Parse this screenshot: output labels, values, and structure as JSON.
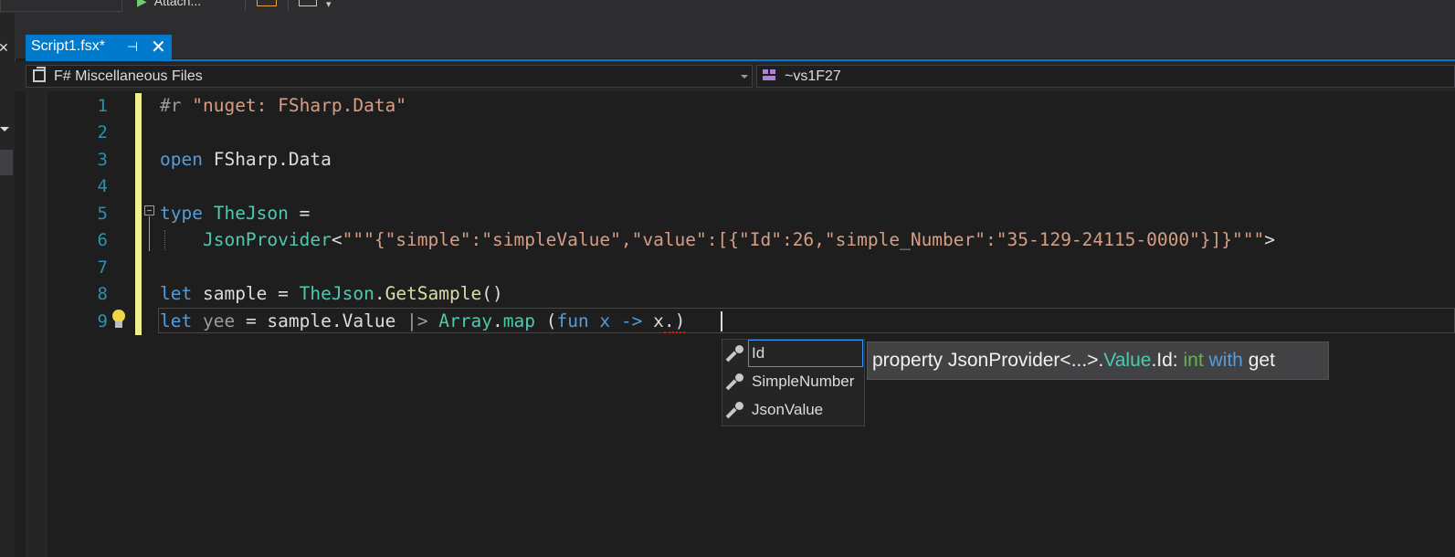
{
  "toolbar": {
    "attach_label": "Attach..."
  },
  "tab": {
    "title": "Script1.fsx*",
    "pin_glyph": "⊣",
    "close_glyph": "✕"
  },
  "nav": {
    "project": "F# Miscellaneous Files",
    "scope": "~vs1F27"
  },
  "line_numbers": [
    "1",
    "2",
    "3",
    "4",
    "5",
    "6",
    "7",
    "8",
    "9"
  ],
  "code": {
    "l1_pp": "#r ",
    "l1_str": "\"nuget: FSharp.Data\"",
    "l3_kw": "open",
    "l3_rest": " FSharp.Data",
    "l5_kw": "type",
    "l5_ty": "TheJson",
    "l5_rest": " =",
    "l6_ty": "JsonProvider",
    "l6_lt": "<",
    "l6_str": "\"\"\"{\"simple\":\"simpleValue\",\"value\":[{\"Id\":26,\"simple_Number\":\"35-129-24115-0000\"}]}\"\"\"",
    "l6_gt": ">",
    "l8_kw": "let",
    "l8_a": " sample = ",
    "l8_ty": "TheJson",
    "l8_dot": ".",
    "l8_fn": "GetSample",
    "l8_paren": "()",
    "l9_kw": "let",
    "l9_name": " yee",
    "l9_a": " = sample.Value ",
    "l9_pipe": "|>",
    "l9_b": " ",
    "l9_ty": "Array",
    "l9_dot": ".",
    "l9_fn": "map",
    "l9_c": " (",
    "l9_kw2": "fun",
    "l9_d": " x ",
    "l9_arrow": "->",
    "l9_e": " x",
    "l9_f": ".)"
  },
  "completion": {
    "items": [
      "Id",
      "SimpleNumber",
      "JsonValue"
    ],
    "icon": "wrench-icon"
  },
  "tooltip": {
    "p1": "property JsonProvider<...>.",
    "p2": "Value",
    "p3": ".Id: ",
    "p4": "int",
    "p5": " ",
    "p6": "with",
    "p7": " get"
  },
  "colors": {
    "accent": "#007acc",
    "keyword": "#569cd6",
    "type": "#4ec9b0",
    "string": "#d69d85",
    "function": "#dcdcaa"
  }
}
